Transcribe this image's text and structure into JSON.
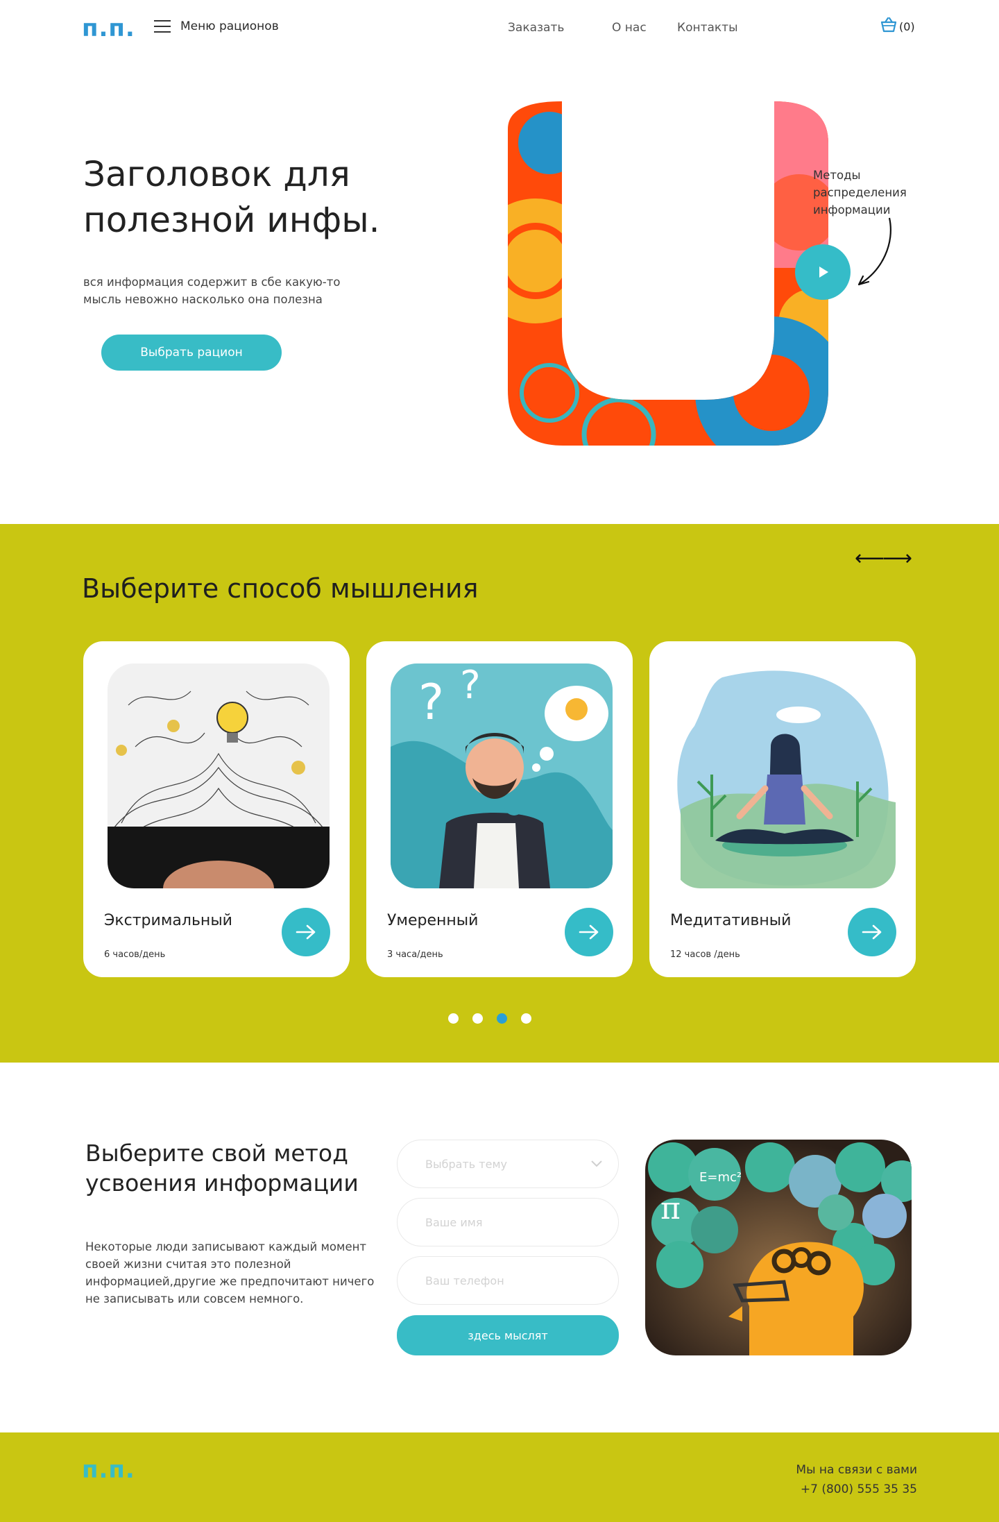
{
  "header": {
    "logo": "п.п.",
    "menu_label": "Меню рационов",
    "nav": [
      "Заказать",
      "О нас",
      "Контакты"
    ],
    "cart_count": "(0)"
  },
  "hero": {
    "title": "Заголовок для полезной инфы.",
    "subtitle": "вся информация содержит в сбе какую-то мысль невожно насколько она полезна",
    "button": "Выбрать рацион",
    "art_note": "Методы распределения информации"
  },
  "thinking": {
    "title": "Выберите способ мышления",
    "cards": [
      {
        "name": "Экстримальный",
        "meta": "6 часов/день"
      },
      {
        "name": "Умеренный",
        "meta": "3 часа/день"
      },
      {
        "name": "Медитативный",
        "meta": "12 часов /день"
      }
    ],
    "pages": 4,
    "active_page": 3
  },
  "method": {
    "title": "Выберите свой метод усвоения информации",
    "text": "Некоторые люди записывают каждый момент своей жизни считая это полезной информацией,другие же предпочитают ничего не записывать или совсем немного.",
    "topic_placeholder": "Выбрать тему",
    "name_placeholder": "Ваше имя",
    "phone_placeholder": "Ваш телефон",
    "submit": "здесь мыслят"
  },
  "footer": {
    "logo": "п.п.",
    "contact_label": "Мы на связи с вами",
    "phone": "+7 (800) 555 35 35"
  },
  "colors": {
    "accent": "#38bcc6",
    "band": "#c9c612",
    "logo": "#2f96d3"
  }
}
